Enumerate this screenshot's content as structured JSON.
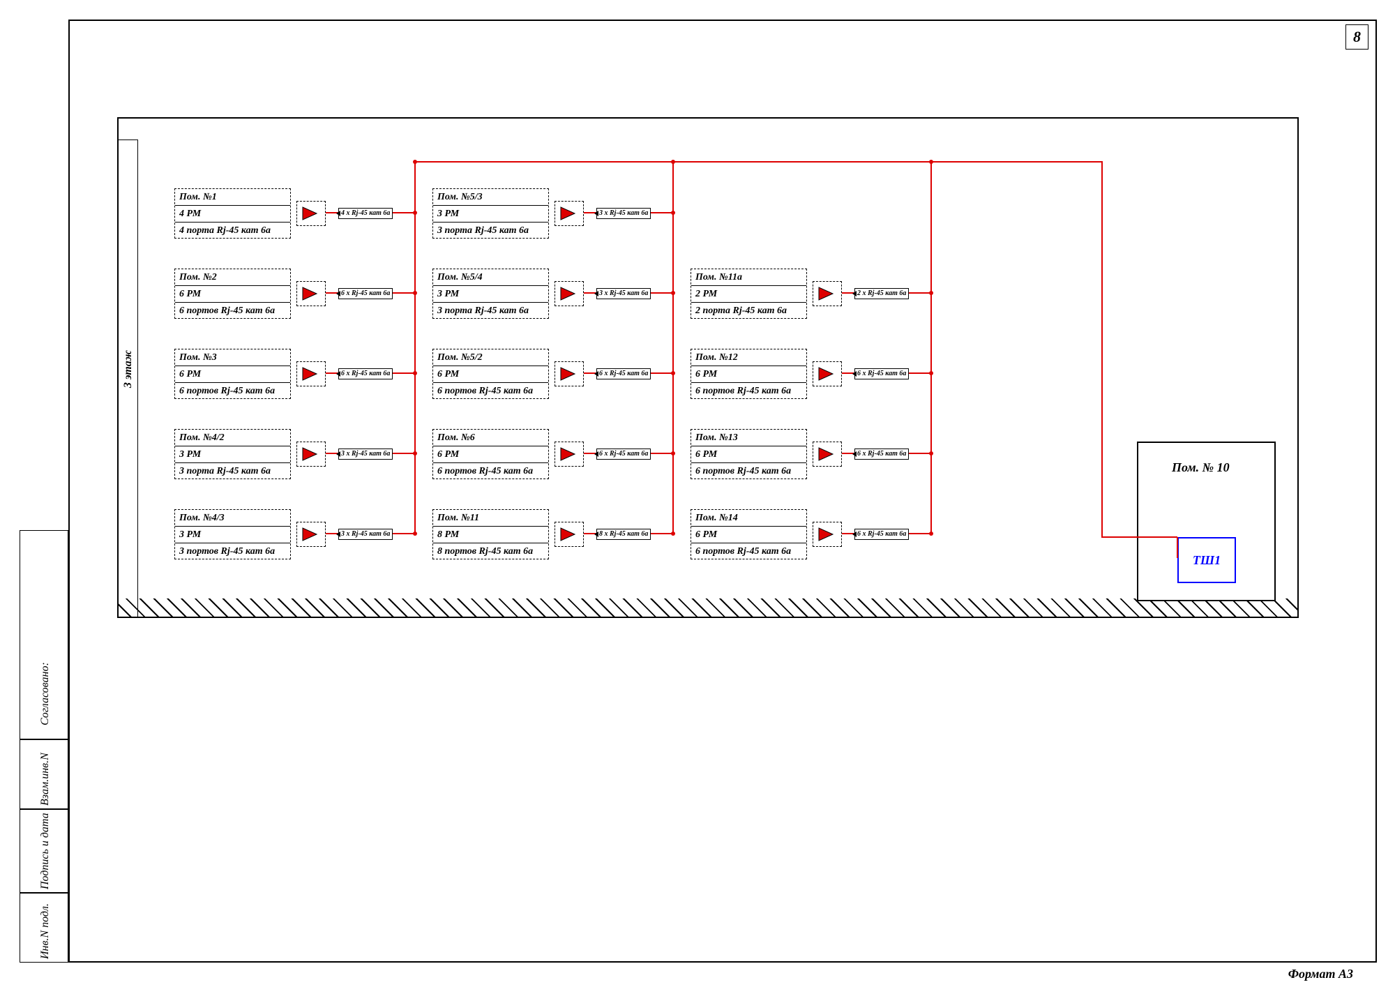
{
  "page_number": "8",
  "paper_format": "Формат А3",
  "floor_label": "3 этаж",
  "side_labels": {
    "agreed": "Согласовано:",
    "inv_replace": "Взам.инв.N",
    "sign_date": "Подпись и дата",
    "inv_orig": "Инв.N подл."
  },
  "cabinet": {
    "room": "Пом. № 10",
    "panel": "ТШ1"
  },
  "columns": [
    [
      {
        "name": "Пом. №1",
        "pm": "4 РМ",
        "ports": "4 порта Rj-45 кат 6а",
        "tag": "4 x Rj-45 кат 6а"
      },
      {
        "name": "Пом. №2",
        "pm": "6 РМ",
        "ports": "6 портов Rj-45 кат 6а",
        "tag": "6 x Rj-45 кат 6а"
      },
      {
        "name": "Пом. №3",
        "pm": "6 РМ",
        "ports": "6 портов Rj-45 кат 6а",
        "tag": "6 x Rj-45 кат 6а"
      },
      {
        "name": "Пом. №4/2",
        "pm": "3 РМ",
        "ports": "3 порта Rj-45 кат 6а",
        "tag": "3 x Rj-45 кат 6а"
      },
      {
        "name": "Пом. №4/3",
        "pm": "3 РМ",
        "ports": "3 портов Rj-45 кат 6а",
        "tag": "3 x Rj-45 кат 6а"
      }
    ],
    [
      {
        "name": "Пом. №5/3",
        "pm": "3 РМ",
        "ports": "3 порта Rj-45 кат 6а",
        "tag": "3 x Rj-45 кат 6а"
      },
      {
        "name": "Пом. №5/4",
        "pm": "3 РМ",
        "ports": "3 порта Rj-45 кат 6а",
        "tag": "3 x Rj-45 кат 6а"
      },
      {
        "name": "Пом. №5/2",
        "pm": "6 РМ",
        "ports": "6 портов Rj-45 кат 6а",
        "tag": "6 x Rj-45 кат 6а"
      },
      {
        "name": "Пом. №6",
        "pm": "6 РМ",
        "ports": "6 портов Rj-45 кат 6а",
        "tag": "6 x Rj-45 кат 6а"
      },
      {
        "name": "Пом. №11",
        "pm": "8 РМ",
        "ports": "8 портов Rj-45 кат 6а",
        "tag": "8 x Rj-45 кат 6а"
      }
    ],
    [
      null,
      {
        "name": "Пом. №11а",
        "pm": "2 РМ",
        "ports": "2 порта Rj-45 кат 6а",
        "tag": "2 x Rj-45 кат 6а"
      },
      {
        "name": "Пом. №12",
        "pm": "6 РМ",
        "ports": "6 портов Rj-45 кат 6а",
        "tag": "6 x Rj-45 кат 6а"
      },
      {
        "name": "Пом. №13",
        "pm": "6 РМ",
        "ports": "6 портов Rj-45 кат 6а",
        "tag": "6 x Rj-45 кат 6а"
      },
      {
        "name": "Пом. №14",
        "pm": "6 РМ",
        "ports": "6 портов Rj-45 кат 6а",
        "tag": "6 x Rj-45 кат 6а"
      }
    ]
  ]
}
